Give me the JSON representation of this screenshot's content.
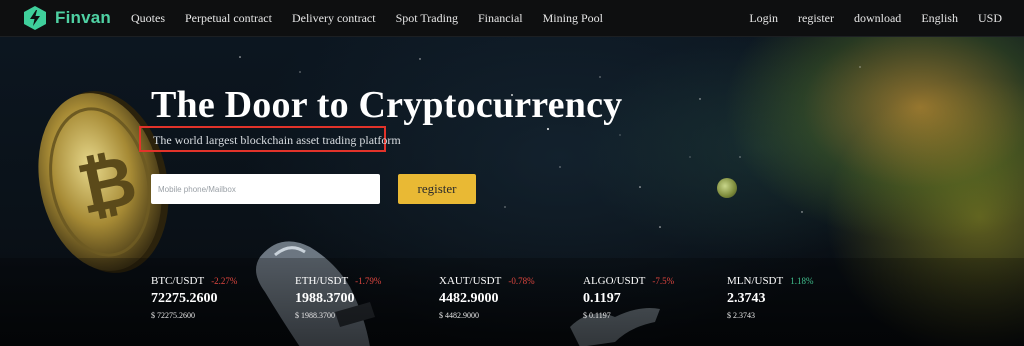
{
  "brand": {
    "name": "Finvan",
    "color": "#4fd1a3"
  },
  "nav": {
    "left": [
      "Quotes",
      "Perpetual contract",
      "Delivery contract",
      "Spot Trading",
      "Financial",
      "Mining Pool"
    ],
    "right": [
      "Login",
      "register",
      "download",
      "English",
      "USD"
    ]
  },
  "hero": {
    "title": "The Door to Cryptocurrency",
    "subtitle": "The world largest blockchain asset trading platform",
    "input_placeholder": "Mobile phone/Mailbox",
    "register_label": "register",
    "accent_color": "#e9b934",
    "highlight_color": "#e2332a"
  },
  "tickers": [
    {
      "pair": "BTC/USDT",
      "change": "-2.27%",
      "direction": "down",
      "price": "72275.2600",
      "usd": "$ 72275.2600"
    },
    {
      "pair": "ETH/USDT",
      "change": "-1.79%",
      "direction": "down",
      "price": "1988.3700",
      "usd": "$ 1988.3700"
    },
    {
      "pair": "XAUT/USDT",
      "change": "-0.78%",
      "direction": "down",
      "price": "4482.9000",
      "usd": "$ 4482.9000"
    },
    {
      "pair": "ALGO/USDT",
      "change": "-7.5%",
      "direction": "down",
      "price": "0.1197",
      "usd": "$ 0.1197"
    },
    {
      "pair": "MLN/USDT",
      "change": "1.18%",
      "direction": "up",
      "price": "2.3743",
      "usd": "$ 2.3743"
    }
  ],
  "colors": {
    "down": "#e0463f",
    "up": "#41c08d"
  }
}
